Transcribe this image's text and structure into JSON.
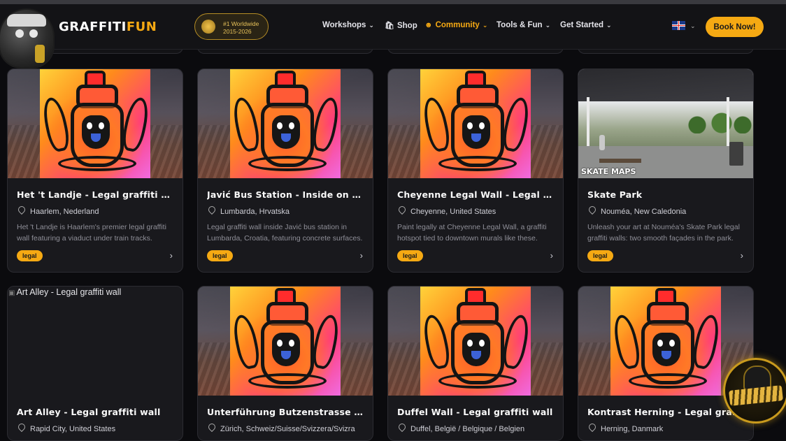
{
  "header": {
    "brand_part1": "GRAFFITI",
    "brand_part2": "FUN",
    "award_line1": "#1 Worldwide",
    "award_line2": "2015-2026",
    "nav": [
      {
        "label": "Workshops",
        "chevron": true
      },
      {
        "label": "Shop",
        "icon": "bag-icon"
      },
      {
        "label": "Community",
        "icon": "users-icon",
        "chevron": true,
        "active": true
      },
      {
        "label": "Tools & Fun",
        "chevron": true
      },
      {
        "label": "Get Started",
        "chevron": true
      }
    ],
    "language_flag": "uk-flag-icon",
    "cta_label": "Book Now!"
  },
  "colors": {
    "accent": "#f5a913",
    "background": "#0b0b0e",
    "card": "#19191d"
  },
  "cards": [
    {
      "title": "Het 't Landje - Legal graffiti wall",
      "location": "Haarlem, Nederland",
      "description": "Het 't Landje is Haarlem's premier legal graffiti wall featuring a viaduct under train tracks.",
      "tag": "legal",
      "image": "graffiti-can-artwork"
    },
    {
      "title": "Javić Bus Station - Inside on the wall",
      "location": "Lumbarda, Hrvatska",
      "description": "Legal graffiti wall inside Javić bus station in Lumbarda, Croatia, featuring concrete surfaces.",
      "tag": "legal",
      "image": "graffiti-can-artwork"
    },
    {
      "title": "Cheyenne Legal Wall - Legal graffiti wall",
      "location": "Cheyenne, United States",
      "description": "Paint legally at Cheyenne Legal Wall, a graffiti hotspot tied to downtown murals like these.",
      "tag": "legal",
      "image": "graffiti-can-artwork"
    },
    {
      "title": "Skate Park",
      "location": "Nouméa, New Caledonia",
      "description": "Unleash your art at Nouméa's Skate Park legal graffiti walls: two smooth façades in the park.",
      "tag": "legal",
      "image": "skate-park-photo",
      "image_watermark": "SKATE MAPS"
    },
    {
      "title": "Art Alley - Legal graffiti wall",
      "location": "Rapid City, United States",
      "image": "broken-image",
      "image_alt": "Art Alley - Legal graffiti wall"
    },
    {
      "title": "Unterführung Butzenstrasse - Legal graffiti wall",
      "location": "Zürich, Schweiz/Suisse/Svizzera/Svizra",
      "image": "graffiti-can-artwork"
    },
    {
      "title": "Duffel Wall - Legal graffiti wall",
      "location": "Duffel, België / Belgique / Belgien",
      "image": "graffiti-can-artwork"
    },
    {
      "title": "Kontrast Herning - Legal graffiti wall",
      "location": "Herning, Danmark",
      "image": "graffiti-can-artwork"
    }
  ],
  "floating_button": "mascot-avatar-icon"
}
